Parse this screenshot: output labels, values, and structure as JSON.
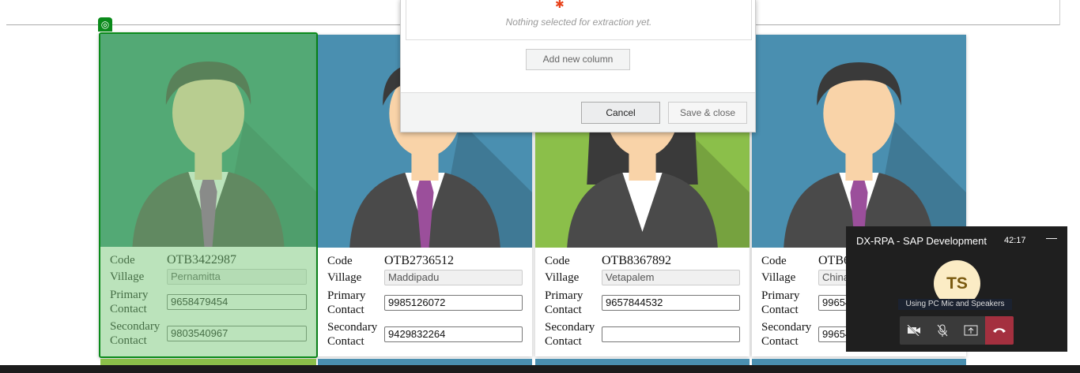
{
  "dialog": {
    "empty_text": "Nothing selected for extraction yet.",
    "add_column": "Add new column",
    "cancel": "Cancel",
    "save_close": "Save & close"
  },
  "labels": {
    "code": "Code",
    "village": "Village",
    "primary": [
      "Primary",
      "Contact"
    ],
    "secondary": [
      "Secondary",
      "Contact"
    ]
  },
  "cards": [
    {
      "code": "OTB3422987",
      "village": "Pernamitta",
      "primary": "9658479454",
      "secondary": "9803540967",
      "bg": "#2e8a72",
      "selected": true
    },
    {
      "code": "OTB2736512",
      "village": "Maddipadu",
      "primary": "9985126072",
      "secondary": "9429832264",
      "bg": "#4a8fb0",
      "selected": false
    },
    {
      "code": "OTB8367892",
      "village": "Vetapalem",
      "primary": "9657844532",
      "secondary": "",
      "bg": "#8bbf4a",
      "selected": false
    },
    {
      "code": "OTB6",
      "village": "China",
      "primary": "99654",
      "secondary": "99654",
      "bg": "#4a8fb0",
      "selected": false
    }
  ],
  "teams": {
    "title": "DX-RPA - SAP Development",
    "timer": "42:17",
    "minimize": "—",
    "initials": "TS",
    "audio_status": "Using PC Mic and Speakers"
  },
  "colors": {
    "selection": "#0a8a1a",
    "hangup": "#a4303f"
  }
}
